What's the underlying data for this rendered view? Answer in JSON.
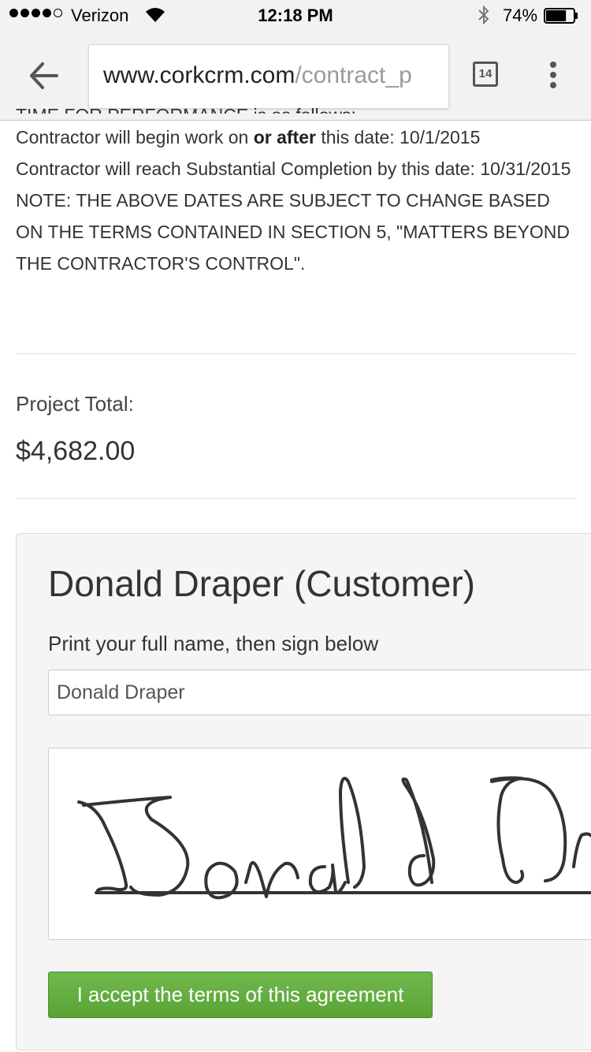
{
  "status_bar": {
    "carrier": "Verizon",
    "time": "12:18 PM",
    "battery": "74%",
    "battery_level": 0.74
  },
  "browser": {
    "url_domain": "www.corkcrm.com",
    "url_path": "/contract_p",
    "tab_count": "14"
  },
  "terms": {
    "cut_heading": "TIME FOR PERFORMANCE is as follows:",
    "begin_prefix": "Contractor will begin work on ",
    "begin_bold": "or after",
    "begin_suffix": " this date: 10/1/2015",
    "completion": "Contractor will reach Substantial Completion by this date: 10/31/2015",
    "note": "NOTE: THE ABOVE DATES ARE SUBJECT TO CHANGE BASED ON THE TERMS CONTAINED IN SECTION 5, \"MATTERS BEYOND THE CONTRACTOR'S CONTROL\"."
  },
  "project": {
    "total_label": "Project Total:",
    "total_value": "$4,682.00"
  },
  "signature": {
    "title": "Donald Draper (Customer)",
    "instruction": "Print your full name, then sign below",
    "name_value": "Donald Draper",
    "signed_text": "Donald Dr"
  },
  "accept_label": "I accept the terms of this agreement"
}
